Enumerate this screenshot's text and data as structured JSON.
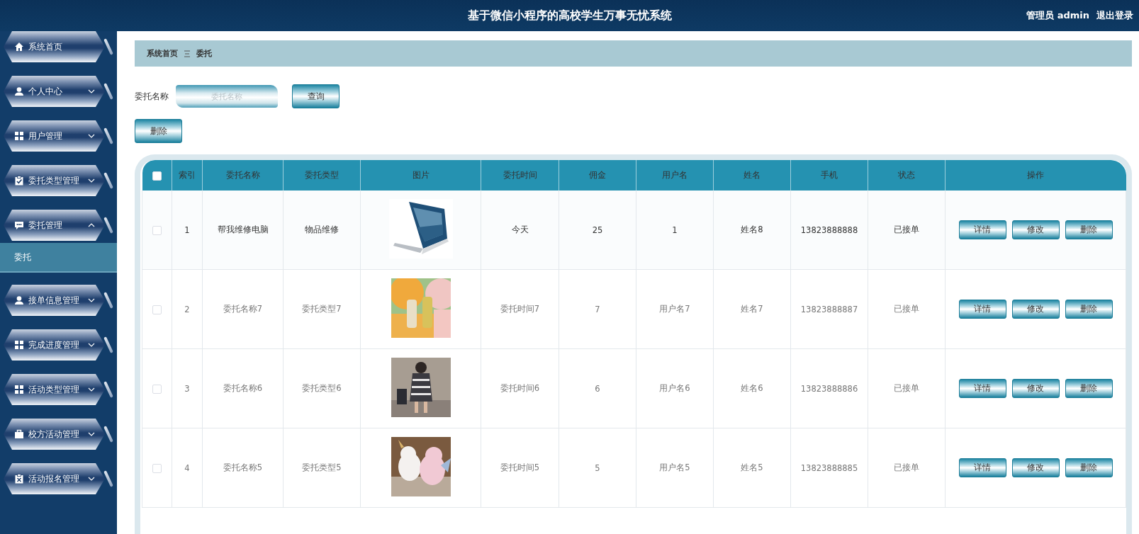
{
  "header": {
    "title": "基于微信小程序的高校学生万事无忧系统",
    "user": "管理员 admin",
    "logout": "退出登录"
  },
  "sidebar": {
    "items": [
      {
        "label": "系统首页",
        "kind": "link"
      },
      {
        "label": "个人中心",
        "kind": "menu",
        "expanded": false
      },
      {
        "label": "用户管理",
        "kind": "menu",
        "expanded": false
      },
      {
        "label": "委托类型管理",
        "kind": "menu",
        "expanded": false
      },
      {
        "label": "委托管理",
        "kind": "menu",
        "expanded": true,
        "children": [
          {
            "label": "委托",
            "selected": true
          }
        ]
      },
      {
        "label": "接单信息管理",
        "kind": "menu",
        "expanded": false
      },
      {
        "label": "完成进度管理",
        "kind": "menu",
        "expanded": false
      },
      {
        "label": "活动类型管理",
        "kind": "menu",
        "expanded": false
      },
      {
        "label": "校方活动管理",
        "kind": "menu",
        "expanded": false
      },
      {
        "label": "活动报名管理",
        "kind": "menu",
        "expanded": false
      }
    ]
  },
  "breadcrumb": [
    "系统首页",
    "委托"
  ],
  "search": {
    "label": "委托名称",
    "placeholder": "委托名称",
    "button": "查询"
  },
  "bulk_delete": "删除",
  "table": {
    "select_all": {
      "checked": false
    },
    "columns": [
      "索引",
      "委托名称",
      "委托类型",
      "图片",
      "委托时间",
      "佣金",
      "用户名",
      "姓名",
      "手机",
      "状态",
      "操作"
    ],
    "rows": [
      {
        "selected": false,
        "hovered": true,
        "index": "1",
        "name": "帮我维修电脑",
        "type": "物品维修",
        "image": {
          "kind": "picture"
        },
        "time": "今天",
        "commission": "25",
        "username": "1",
        "real_name": "姓名8",
        "phone": "13823888888",
        "status": "已接单",
        "actions": [
          "详情",
          "修改",
          "删除"
        ]
      },
      {
        "selected": false,
        "hovered": false,
        "index": "2",
        "name": "委托名称7",
        "type": "委托类型7",
        "image": {
          "kind": "picture"
        },
        "time": "委托时间7",
        "commission": "7",
        "username": "用户名7",
        "real_name": "姓名7",
        "phone": "13823888887",
        "status": "已接单",
        "actions": [
          "详情",
          "修改",
          "删除"
        ]
      },
      {
        "selected": false,
        "hovered": false,
        "index": "3",
        "name": "委托名称6",
        "type": "委托类型6",
        "image": {
          "kind": "picture"
        },
        "time": "委托时间6",
        "commission": "6",
        "username": "用户名6",
        "real_name": "姓名6",
        "phone": "13823888886",
        "status": "已接单",
        "actions": [
          "详情",
          "修改",
          "删除"
        ]
      },
      {
        "selected": false,
        "hovered": false,
        "index": "4",
        "name": "委托名称5",
        "type": "委托类型5",
        "image": {
          "kind": "picture"
        },
        "time": "委托时间5",
        "commission": "5",
        "username": "用户名5",
        "real_name": "姓名5",
        "phone": "13823888885",
        "status": "已接单",
        "actions": [
          "详情",
          "修改",
          "删除"
        ]
      }
    ]
  }
}
